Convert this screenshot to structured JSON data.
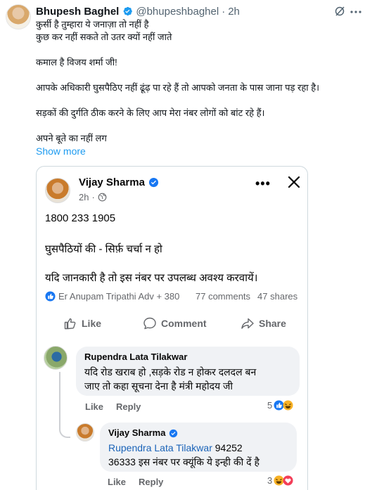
{
  "tweet": {
    "author_name": "Bhupesh Baghel",
    "handle": "@bhupeshbaghel",
    "separator": "·",
    "time": "2h",
    "lines": [
      "कुर्सी है तुम्हारा ये जनाज़ा तो नहीं है",
      "कुछ कर नहीं सकते तो उतर क्यों नहीं जाते",
      "",
      "कमाल है विजय शर्मा जी!",
      "",
      "आपके अधिकारी घुसपैठिए नहीं ढूंढ़ पा रहे हैं तो आपको जनता के पास जाना पड़ रहा है।",
      "",
      "सड़कों की दुर्गति ठीक करने के लिए  आप मेरा नंबर लोगों को बांट रहे हैं।",
      "",
      "अपने बूते का नहीं लग"
    ],
    "show_more": "Show more",
    "colors": {
      "verified": "#1d9bf0",
      "link": "#1d9bf0"
    }
  },
  "fb_post": {
    "author_name": "Vijay Sharma",
    "time": "2h",
    "separator": "·",
    "more": "•••",
    "phone": "1800 233 1905",
    "line2": "घुसपैठियों की - सिर्फ़ चर्चा न हो",
    "line3": "यदि जानकारी है तो इस नंबर पर उपलब्ध अवश्य  करवायें।",
    "reaction_text": "Er Anupam Tripathi Adv + 380",
    "comments_count": "77 comments",
    "shares_count": "47 shares",
    "actions": {
      "like": "Like",
      "comment": "Comment",
      "share": "Share"
    },
    "colors": {
      "verified": "#1877f2",
      "mention": "#1a63b8"
    }
  },
  "comments": [
    {
      "name": "Rupendra Lata Tilakwar",
      "lines": [
        "यदि रोड खराब हो ,सड़के रोड न होकर दलदल बन",
        "जाए तो कहा सूचना देना है मंत्री महोदय जी"
      ],
      "like": "Like",
      "reply": "Reply",
      "reaction_count": "5"
    },
    {
      "name": "Vijay Sharma",
      "mention": "Rupendra Lata Tilakwar",
      "line1_rest": " 94252",
      "line2": "36333 इस नंबर पर क्यूंकि ये इन्ही की दें है",
      "like": "Like",
      "reply": "Reply",
      "reaction_count": "3"
    }
  ]
}
